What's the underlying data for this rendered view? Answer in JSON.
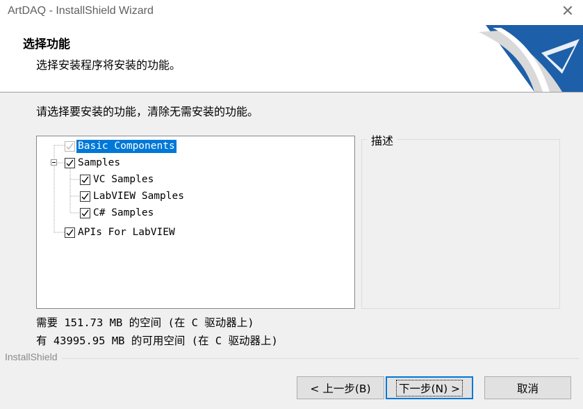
{
  "window": {
    "title": "ArtDAQ - InstallShield Wizard",
    "close_glyph": "✕"
  },
  "header": {
    "title": "选择功能",
    "subtitle": "选择安装程序将安装的功能。",
    "logo_icon": "installshield-logo-icon"
  },
  "instructions": "请选择要安装的功能，清除无需安装的功能。",
  "tree": {
    "items": [
      {
        "label": "Basic Components",
        "checked": true,
        "disabled": true,
        "selected": true
      },
      {
        "label": "Samples",
        "checked": true,
        "expanded": true
      },
      {
        "label": "VC Samples",
        "checked": true
      },
      {
        "label": "LabVIEW Samples",
        "checked": true
      },
      {
        "label": "C# Samples",
        "checked": true
      },
      {
        "label": "APIs For LabVIEW",
        "checked": true
      }
    ]
  },
  "description": {
    "legend": "描述"
  },
  "space": {
    "required": "需要 151.73 MB 的空间 (在 C 驱动器上)",
    "available": "有 43995.95 MB 的可用空间 (在 C 驱动器上)"
  },
  "brand": "InstallShield",
  "buttons": {
    "back": "< 上一步(B)",
    "next": "下一步(N) >",
    "cancel": "取消"
  },
  "colors": {
    "selection": "#0078d7",
    "logo_blue": "#1d5fa8"
  }
}
